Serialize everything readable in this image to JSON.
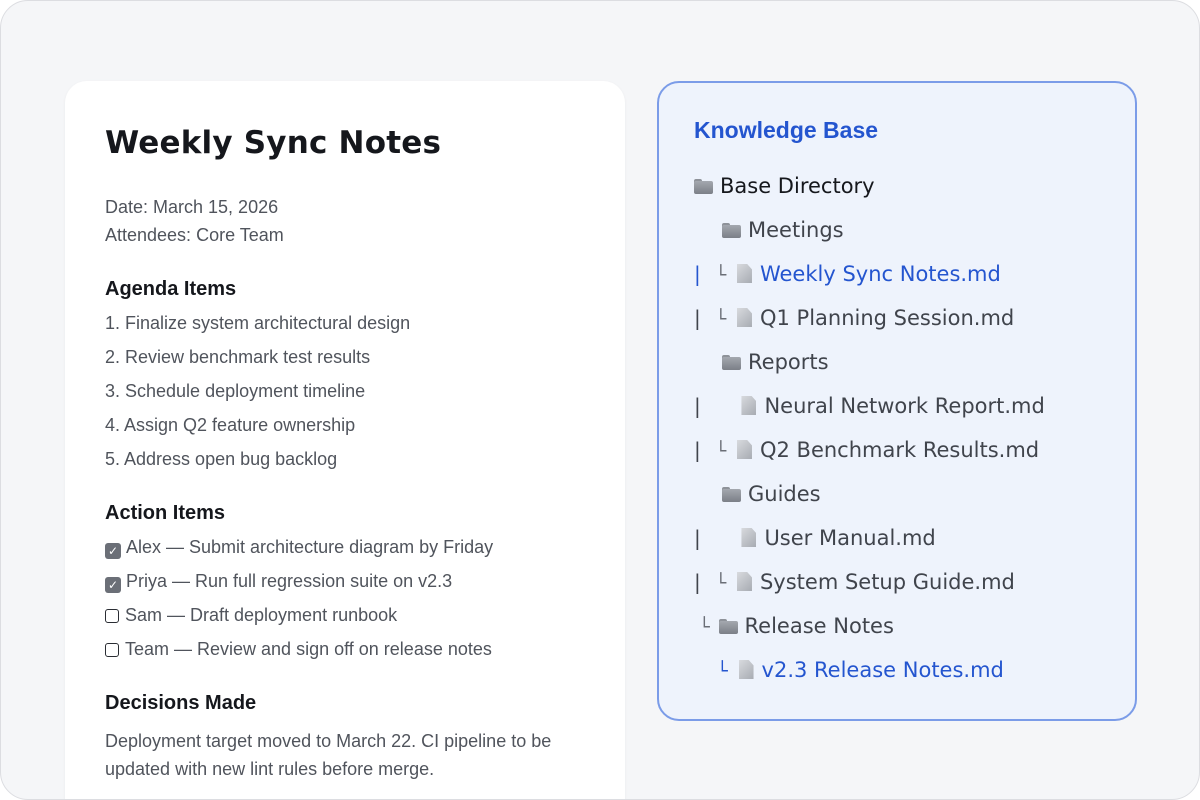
{
  "document": {
    "title": "Weekly Sync Notes",
    "date": "Date: March 15, 2026",
    "attendees": "Attendees: Core Team",
    "agenda_heading": "Agenda Items",
    "agenda": [
      "1. Finalize system architectural design",
      "2. Review benchmark test results",
      "3. Schedule deployment timeline",
      "4. Assign Q2 feature ownership",
      "5. Address open bug backlog"
    ],
    "actions_heading": "Action Items",
    "actions": [
      {
        "text": "Alex — Submit architecture diagram by Friday",
        "checked": true
      },
      {
        "text": "Priya — Run full regression suite on v2.3",
        "checked": true
      },
      {
        "text": "Sam — Draft deployment runbook",
        "checked": false
      },
      {
        "text": "Team — Review and sign off on release notes",
        "checked": false
      }
    ],
    "decisions_heading": "Decisions Made",
    "decisions_text": "Deployment target moved to March 22. CI pipeline to be updated with new lint rules before merge."
  },
  "knowledge_base": {
    "title": "Knowledge Base",
    "tree": [
      {
        "label": "Base Directory",
        "type": "folder"
      },
      {
        "label": "Meetings",
        "type": "folder"
      },
      {
        "label": "Weekly Sync Notes.md",
        "type": "file",
        "active": true
      },
      {
        "label": "Q1 Planning Session.md",
        "type": "file"
      },
      {
        "label": "Reports",
        "type": "folder"
      },
      {
        "label": "Neural Network Report.md",
        "type": "file"
      },
      {
        "label": "Q2 Benchmark Results.md",
        "type": "file"
      },
      {
        "label": "Guides",
        "type": "folder"
      },
      {
        "label": "User Manual.md",
        "type": "file"
      },
      {
        "label": "System Setup Guide.md",
        "type": "file"
      },
      {
        "label": "Release Notes",
        "type": "folder"
      },
      {
        "label": "v2.3 Release Notes.md",
        "type": "file",
        "active": true
      }
    ],
    "connectors": {
      "pipe": "|",
      "elbow": "└"
    }
  },
  "icons": {
    "folder": "folder-icon",
    "file": "file-icon",
    "checkbox_checked": "✓"
  },
  "colors": {
    "accent": "#2455cf",
    "panel_border": "#7b9ce8",
    "panel_bg": "#eef3fc"
  }
}
